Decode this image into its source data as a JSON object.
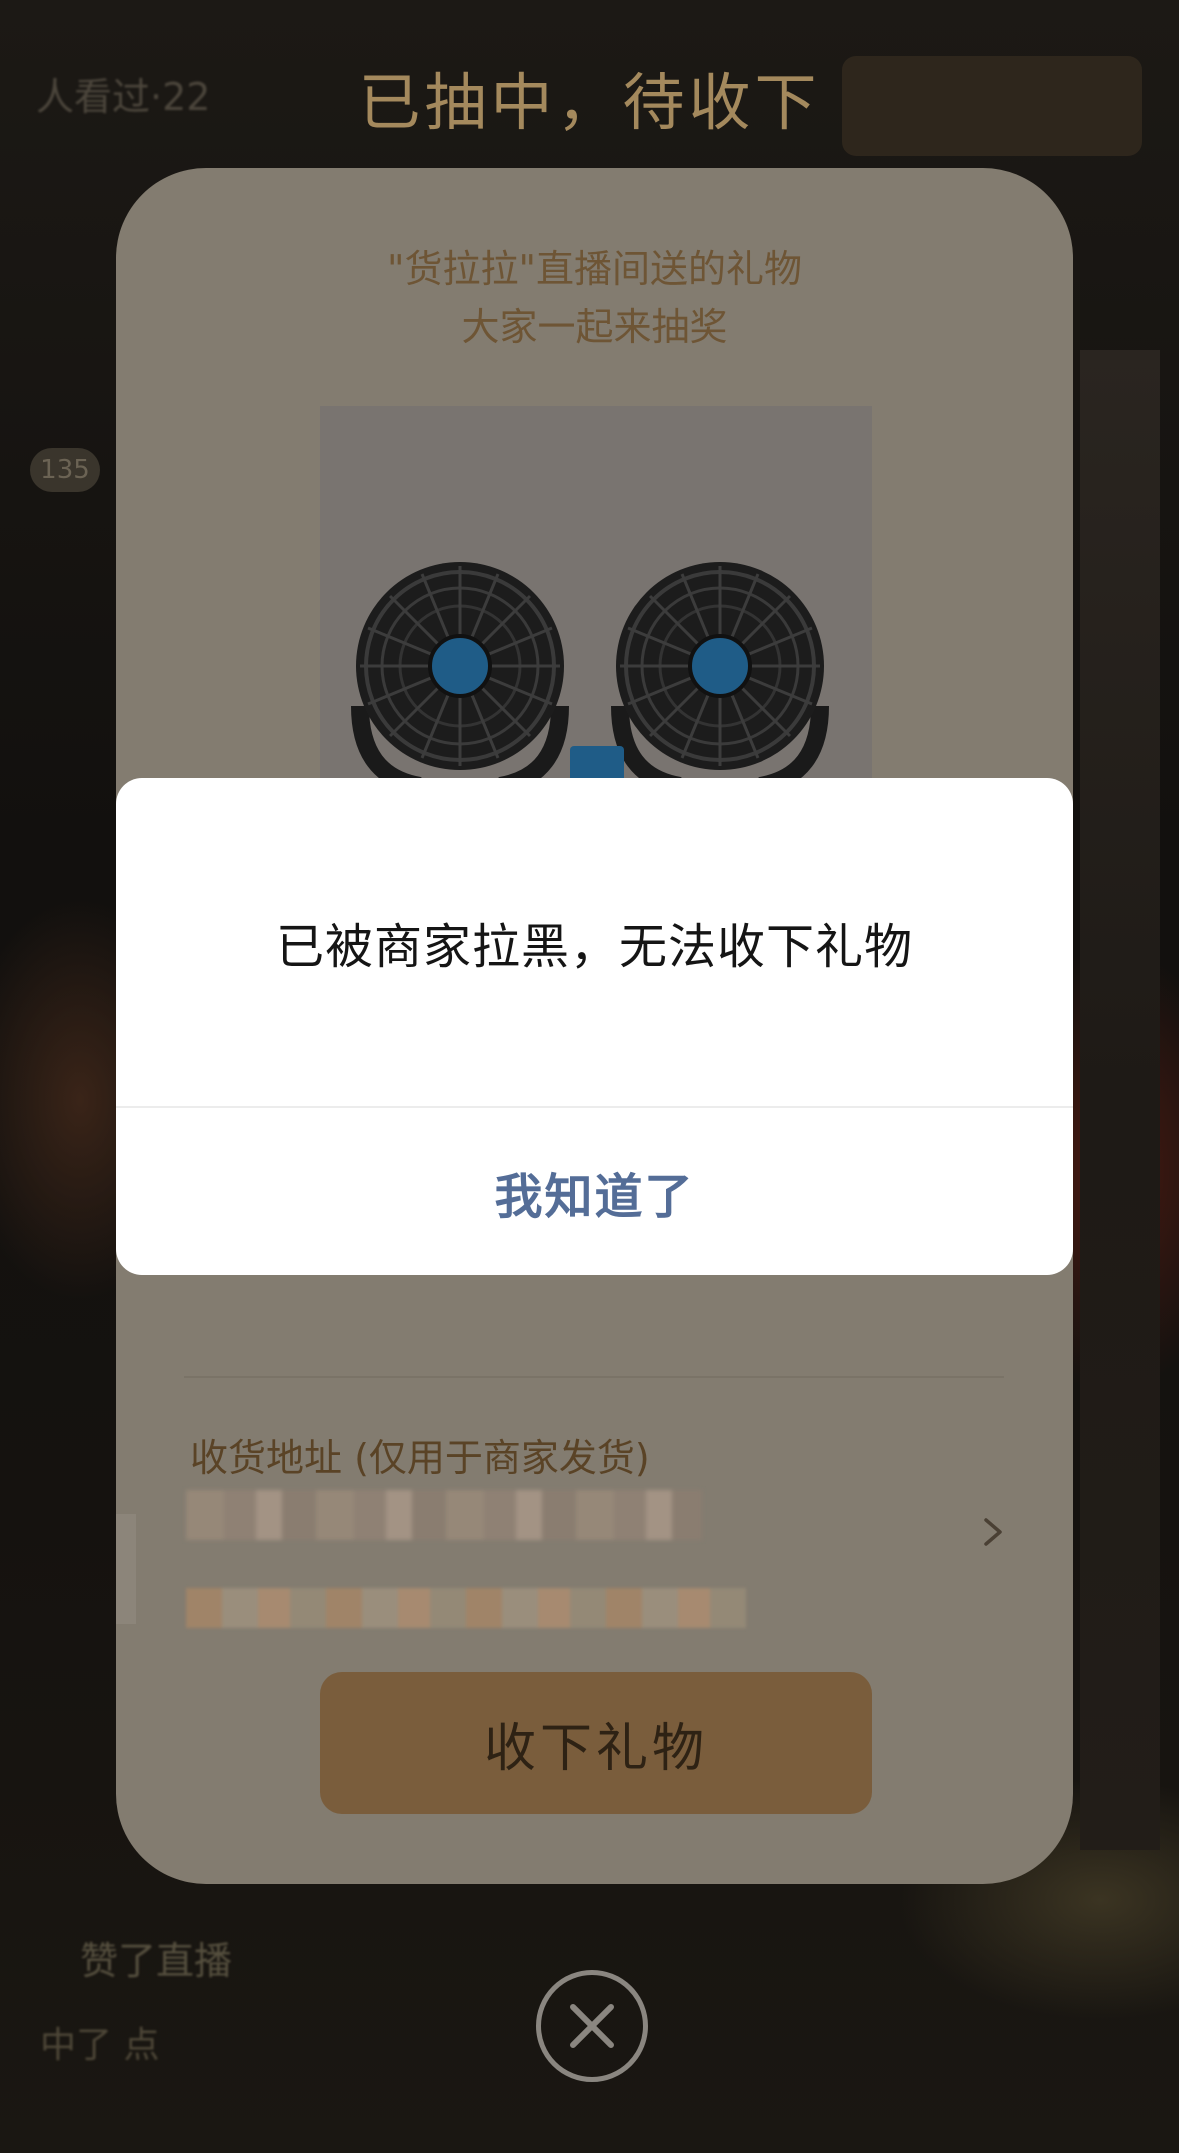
{
  "background": {
    "viewed_text": "人看过·22",
    "count_badge": "135",
    "liked_text": "赞了直播",
    "won_text": "中了 点"
  },
  "header": {
    "title": "已抽中，待收下"
  },
  "gift_card": {
    "subtitle_line1": "\"货拉拉\"直播间送的礼物",
    "subtitle_line2": "大家一起来抽奖",
    "product_image": "dual-car-fan-image",
    "address_label": "收货地址 (仅用于商家发货)",
    "accept_button_label": "收下礼物"
  },
  "alert": {
    "message": "已被商家拉黑，无法收下礼物",
    "confirm_label": "我知道了"
  },
  "icons": {
    "chevron": "chevron-right-icon",
    "close": "close-icon"
  },
  "colors": {
    "title_gold": "#a4895d",
    "accept_button": "#7a5d3c",
    "confirm_text": "#546d97"
  }
}
